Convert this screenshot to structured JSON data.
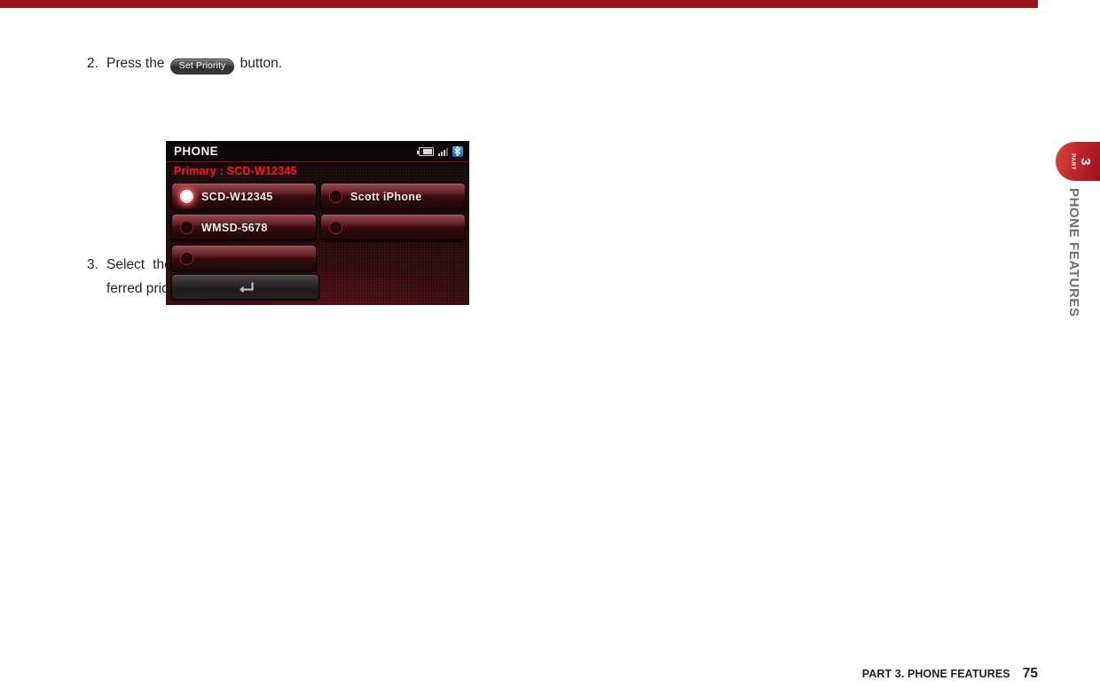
{
  "page": {
    "footer_title": "PART 3. PHONE FEATURES",
    "footer_page": "75"
  },
  "side_tab": {
    "part_label": "PART",
    "part_number": "3",
    "section_label": "PHONE FEATURES",
    "color": "#9c131c"
  },
  "steps": [
    {
      "number": "2.",
      "before": "Press the",
      "keycap": "Set Priority",
      "after": "button."
    },
    {
      "number": "3.",
      "line1": "Select the phone you wish to set as pre-",
      "line2": "ferred priority."
    }
  ],
  "device": {
    "title": "PHONE",
    "primary_line": "Primary : SCD-W12345",
    "status_icons": [
      "battery-icon",
      "signal-icon",
      "bluetooth-icon"
    ],
    "back_button_icon": "back-arrow-icon",
    "accent_color": "#e02026",
    "items": [
      {
        "label": "SCD-W12345",
        "selected": true,
        "empty": false
      },
      {
        "label": "Scott iPhone",
        "selected": false,
        "empty": false
      },
      {
        "label": "WMSD-5678",
        "selected": false,
        "empty": false
      },
      {
        "label": "",
        "selected": false,
        "empty": true
      },
      {
        "label": "",
        "selected": false,
        "empty": true
      },
      {
        "label": "",
        "selected": false,
        "empty": true,
        "hidden": true
      }
    ]
  }
}
